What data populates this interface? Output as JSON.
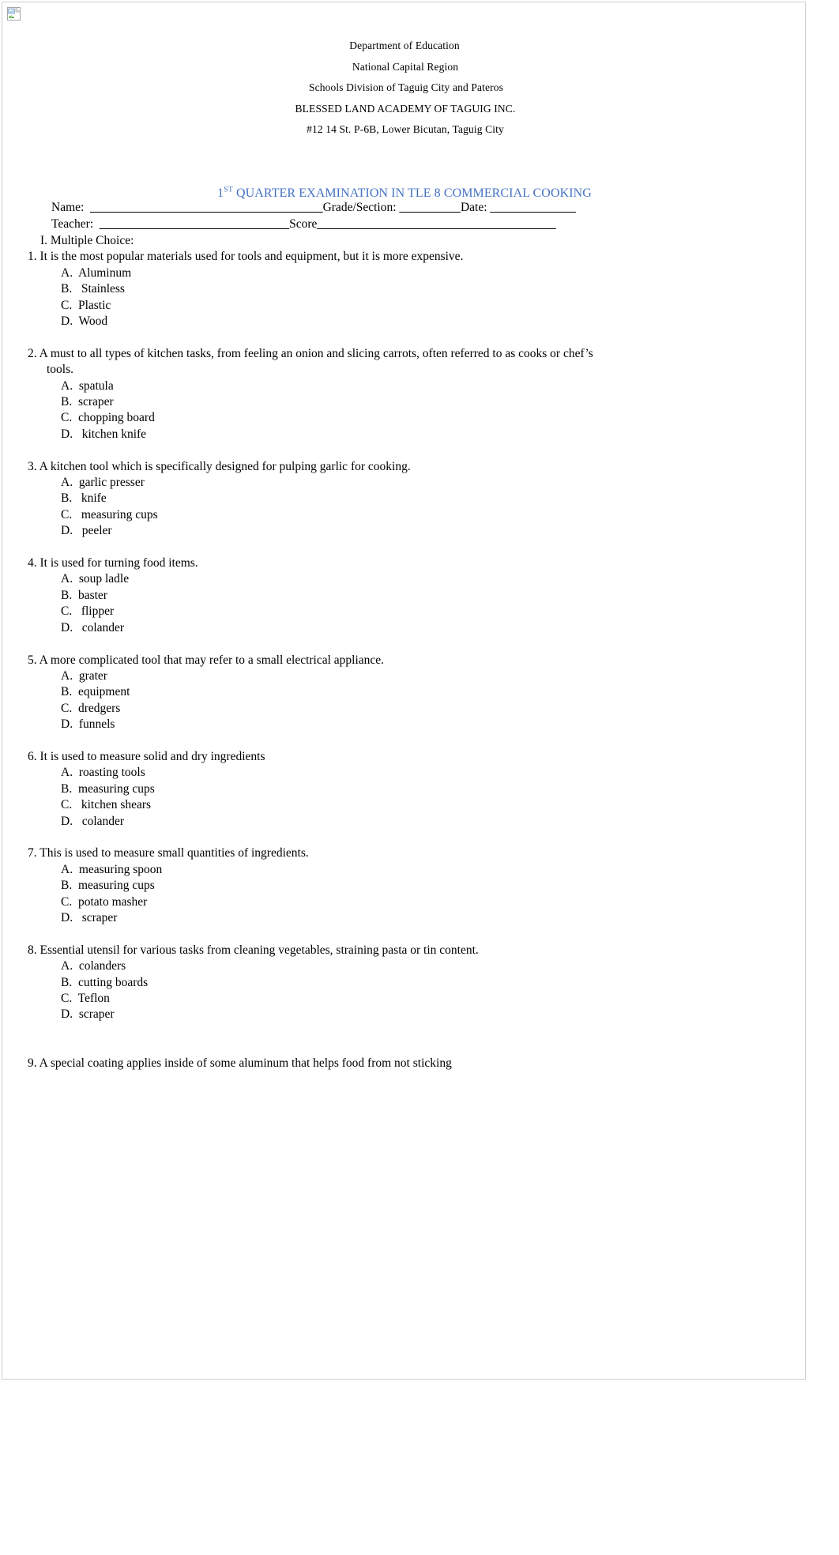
{
  "document": {
    "logo_alt": "broken-image-placeholder",
    "header_lines": [
      "Department of Education",
      "National Capital Region",
      "Schools Division of Taguig City and Pateros",
      "BLESSED LAND ACADEMY OF TAGUIG INC.",
      "#12 14 St. P-6B, Lower Bicutan, Taguig City"
    ],
    "title": {
      "ordinal_number": "1",
      "ordinal_suffix": "ST",
      "rest": " QUARTER EXAMINATION IN TLE 8 COMMERCIAL COOKING",
      "color": "#4472c4"
    },
    "info_line_1": {
      "name_label": "Name:  ",
      "name_blank": "______________________________________",
      "grade_label": "Grade/Section: ",
      "grade_blank": "__________",
      "date_label": "Date: ",
      "date_blank": "______________"
    },
    "info_line_2": {
      "teacher_label": "Teacher:  ",
      "teacher_blank": "_______________________________",
      "score_label": "Score",
      "score_blank": "_______________________________________"
    },
    "section_label": "I. Multiple Choice:",
    "questions": [
      {
        "number": "1.",
        "text": "It is the most popular materials used for tools and equipment, but it is more expensive.",
        "continuation": "",
        "choices": [
          "A.  Aluminum",
          "B.   Stainless",
          "C.  Plastic",
          "D.  Wood"
        ]
      },
      {
        "number": "2.",
        "text": "A must to all types of kitchen tasks, from feeling an onion and slicing carrots, often referred to as cooks or chef’s",
        "continuation": "tools.",
        "choices": [
          "A.  spatula",
          "B.  scraper",
          "C.  chopping board",
          "D.   kitchen knife"
        ]
      },
      {
        "number": "3.",
        "text": "A kitchen tool which is specifically designed for pulping garlic for cooking.",
        "continuation": "",
        "choices": [
          "A.  garlic presser",
          "B.   knife",
          "C.   measuring cups",
          "D.   peeler"
        ]
      },
      {
        "number": "4.",
        "text": "It is used for turning food items.",
        "continuation": "",
        "choices": [
          "A.  soup ladle",
          "B.  baster",
          "C.   flipper",
          "D.   colander"
        ]
      },
      {
        "number": "5.",
        "text": "A more complicated tool that may refer to a small electrical appliance.",
        "continuation": "",
        "choices": [
          "A.  grater",
          "B.  equipment",
          "C.  dredgers",
          "D.  funnels"
        ]
      },
      {
        "number": "6.",
        "text": "It is used to measure solid and dry ingredients",
        "continuation": "",
        "choices": [
          "A.  roasting tools",
          "B.  measuring cups",
          "C.   kitchen shears",
          "D.   colander"
        ]
      },
      {
        "number": "7.",
        "text": "This is used to measure small quantities of ingredients.",
        "continuation": "",
        "choices": [
          "A.  measuring spoon",
          "B.  measuring cups",
          "C.  potato masher",
          "D.   scraper"
        ]
      },
      {
        "number": "8.",
        "text": "Essential utensil for various tasks from cleaning vegetables, straining pasta or tin content.",
        "continuation": "",
        "choices": [
          "A.  colanders",
          "B.  cutting boards",
          "C.  Teflon",
          "D.  scraper"
        ]
      },
      {
        "number": "9.",
        "text": "A special coating applies inside of some aluminum that helps food from not sticking",
        "continuation": "",
        "choices": []
      }
    ]
  }
}
